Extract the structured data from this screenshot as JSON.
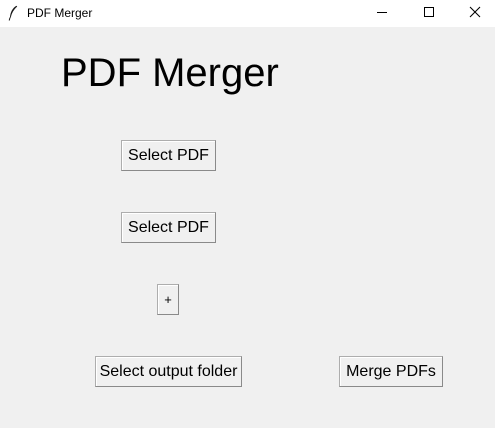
{
  "window": {
    "title": "PDF Merger",
    "icon": "feather-icon"
  },
  "controls": {
    "minimize_icon": "minimize-icon",
    "maximize_icon": "maximize-icon",
    "close_icon": "close-icon"
  },
  "main": {
    "heading": "PDF Merger",
    "select_pdf_1": "Select PDF",
    "select_pdf_2": "Select PDF",
    "add_button": "+",
    "select_output": "Select output folder",
    "merge_button": "Merge PDFs"
  },
  "colors": {
    "background": "#f0f0f0",
    "titlebar": "#ffffff",
    "button_border": "#adadad"
  }
}
